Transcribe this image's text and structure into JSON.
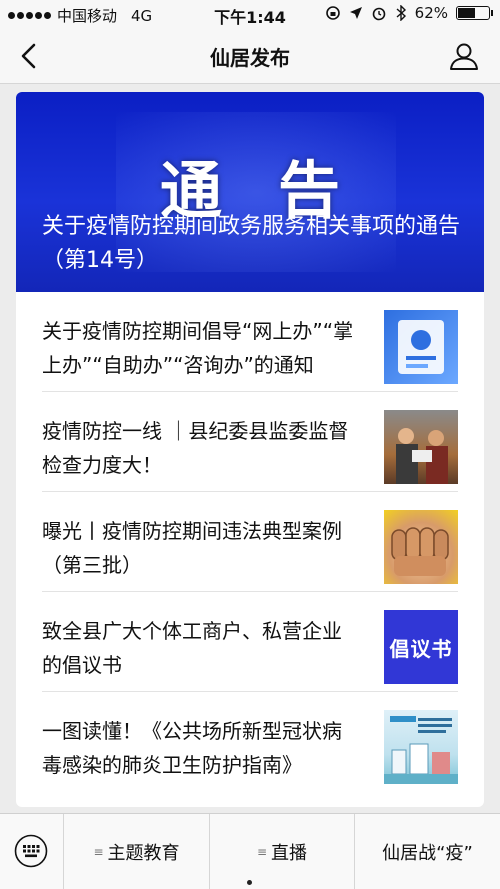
{
  "status_bar": {
    "carrier": "中国移动",
    "network": "4G",
    "time": "下午1:44",
    "battery_percent": "62%",
    "battery_level": 0.62
  },
  "nav": {
    "title": "仙居发布"
  },
  "banner": {
    "big_text": "通告",
    "title": "关于疫情防控期间政务服务相关事项的通告（第14号）"
  },
  "articles": [
    {
      "title": "关于疫情防控期间倡导“网上办”“掌上办”“自助办”“咨询办”的通知"
    },
    {
      "title": "疫情防控一线 ｜县纪委县监委监督检查力度大！"
    },
    {
      "title": "曝光丨疫情防控期间违法典型案例（第三批）"
    },
    {
      "title": "致全县广大个体工商户、私营企业的倡议书",
      "thumb_text": "倡议书"
    },
    {
      "title": "一图读懂！《公共场所新型冠状病毒感染的肺炎卫生防护指南》"
    }
  ],
  "bottom_menu": {
    "items": [
      "主题教育",
      "直播",
      "仙居战“疫”"
    ]
  },
  "colors": {
    "banner_blue": "#1a33d8",
    "thumb_blue": "#3137d6",
    "background": "#ececec"
  },
  "icons": [
    "signal-dots-icon",
    "location-arrow-icon",
    "alarm-icon",
    "bluetooth-icon",
    "battery-icon",
    "back-chevron-icon",
    "profile-icon",
    "keyboard-icon",
    "menu-lines-icon"
  ]
}
